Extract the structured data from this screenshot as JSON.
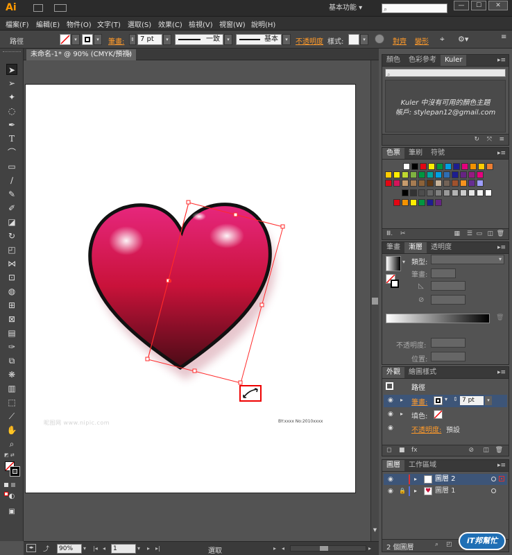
{
  "app": {
    "logo": "Ai",
    "workspace": "基本功能"
  },
  "window_buttons": {
    "minimize": "—",
    "maximize": "☐",
    "close": "✕"
  },
  "menu": [
    "檔案(F)",
    "編輯(E)",
    "物件(O)",
    "文字(T)",
    "選取(S)",
    "效果(C)",
    "檢視(V)",
    "視窗(W)",
    "說明(H)"
  ],
  "control_bar": {
    "object_type": "路徑",
    "stroke_label": "筆畫:",
    "stroke_weight": "7 pt",
    "stroke_profile": "一致",
    "brush": "基本",
    "opacity_label": "不透明度",
    "style_label": "樣式:",
    "align_label": "對齊",
    "transform_label": "變形"
  },
  "document": {
    "tab": "未命名-1* @ 90% (CMYK/預視)",
    "close": "×"
  },
  "status": {
    "zoom": "90%",
    "page": "1",
    "tool": "選取"
  },
  "watermark": {
    "left": "昵图网 www.nipic.com",
    "right": "BY:xxxx No:2010xxxx"
  },
  "kuler_panel": {
    "tabs": [
      "顏色",
      "色彩參考",
      "Kuler"
    ],
    "message": "Kuler 中沒有可用的顏色主題",
    "account": "帳戶: stylepan12@gmail.com"
  },
  "swatch_panel": {
    "tabs": [
      "色票",
      "筆刷",
      "符號"
    ],
    "row1": [
      "#ffffff",
      "#000000",
      "#e30613",
      "#ffed00",
      "#009640",
      "#00a0e3",
      "#1d1d8f",
      "#e5007d",
      "#f39200",
      "#ffcc00",
      "#ed7d31"
    ],
    "row2": [
      "#ffcc00",
      "#ffed00",
      "#bfd730",
      "#7fb241",
      "#009640",
      "#00a6a0",
      "#00a0e3",
      "#2e6db4",
      "#1d1d8f",
      "#662483",
      "#951b81",
      "#e5007d"
    ],
    "row3": [
      "#e30613",
      "#d4145a",
      "#c69c6d",
      "#a67c52",
      "#8c6239",
      "#603813",
      "#c7b299",
      "#736357",
      "#a0522d",
      "#f7931e",
      "#662d91",
      "#9e9eff"
    ],
    "row4": [
      "#000000",
      "#333333",
      "#4d4d4d",
      "#666666",
      "#808080",
      "#999999",
      "#b3b3b3",
      "#cccccc",
      "#e6e6e6",
      "#f2f2f2",
      "#ffffff"
    ],
    "row5": [
      "#e30613",
      "#f39200",
      "#ffed00",
      "#009640",
      "#1d1d8f",
      "#662483"
    ]
  },
  "stroke_panel": {
    "tabs": [
      "筆畫",
      "漸層",
      "透明度"
    ],
    "type_label": "類型:",
    "stroke_label": "筆畫:",
    "opacity_label": "不透明度:",
    "position_label": "位置:"
  },
  "appearance_panel": {
    "tabs": [
      "外觀",
      "繪圖樣式"
    ],
    "title": "路徑",
    "stroke_label": "筆畫:",
    "stroke_weight": "7 pt",
    "fill_label": "填色:",
    "opacity_label": "不透明度:",
    "opacity_value": "預設"
  },
  "layers_panel": {
    "tabs": [
      "圖層",
      "工作區域"
    ],
    "layers": [
      {
        "name": "圖層 2",
        "color": "#e0322f"
      },
      {
        "name": "圖層 1",
        "color": "#4f6fe0"
      }
    ],
    "count": "2 個圖層"
  },
  "ithome": {
    "text": "iT邦幫忙"
  }
}
